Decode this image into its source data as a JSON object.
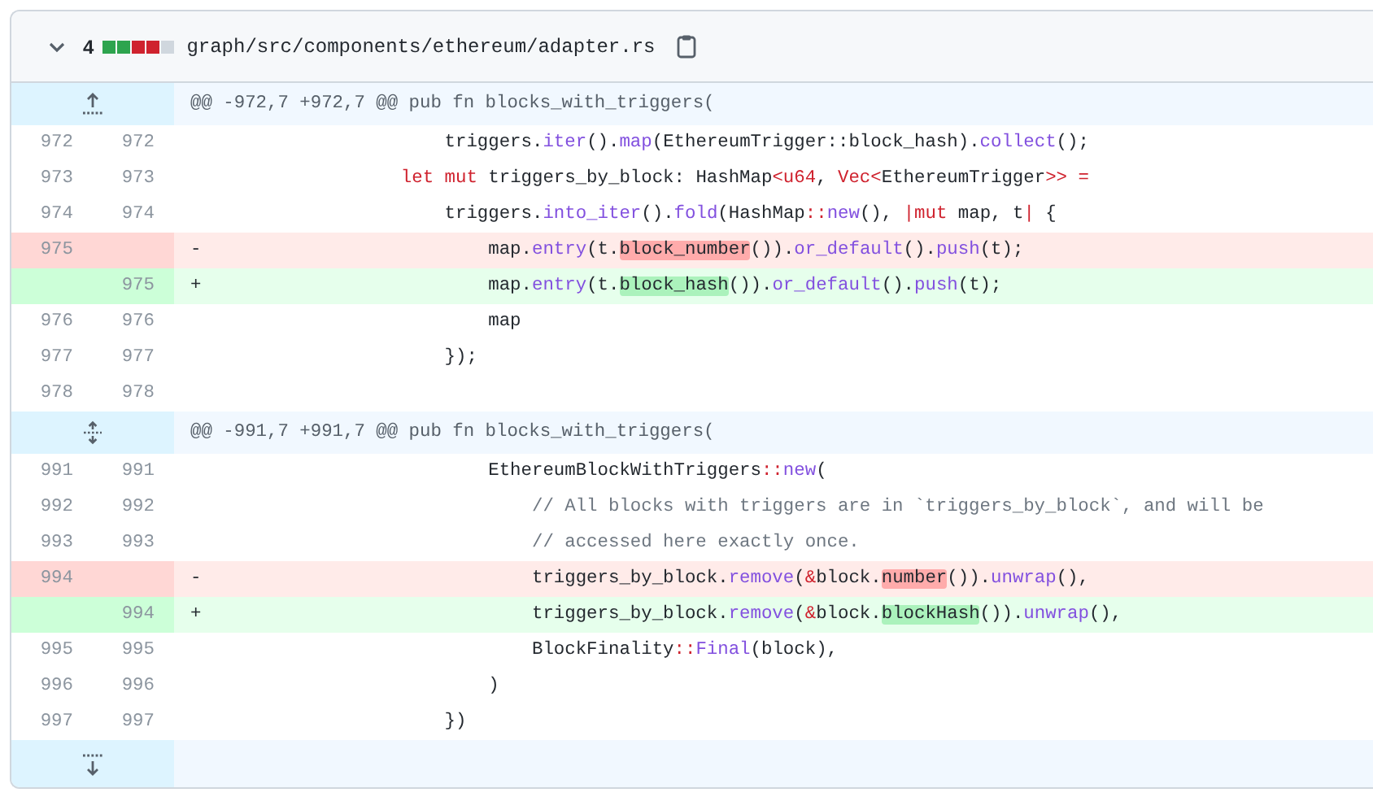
{
  "file": {
    "changes": "4",
    "diffstat": [
      {
        "kind": "add"
      },
      {
        "kind": "add"
      },
      {
        "kind": "del"
      },
      {
        "kind": "del"
      },
      {
        "kind": "neutral"
      }
    ],
    "path": "graph/src/components/ethereum/adapter.rs"
  },
  "hunks": [
    {
      "kind": "up",
      "header": "@@ -972,7 +972,7 @@ pub fn blocks_with_triggers(",
      "lines": [
        {
          "kind": "context",
          "old": "972",
          "new": "972",
          "tokens": [
            {
              "t": "                    triggers.",
              "kind": "plain"
            },
            {
              "t": "iter",
              "kind": "method"
            },
            {
              "t": "().",
              "kind": "plain"
            },
            {
              "t": "map",
              "kind": "method"
            },
            {
              "t": "(EthereumTrigger::block_hash).",
              "kind": "plain"
            },
            {
              "t": "collect",
              "kind": "method"
            },
            {
              "t": "();",
              "kind": "plain"
            }
          ]
        },
        {
          "kind": "context",
          "old": "973",
          "new": "973",
          "tokens": [
            {
              "t": "                let mut",
              "kind": "keyword"
            },
            {
              "t": " triggers_by_block: HashMap",
              "kind": "plain"
            },
            {
              "t": "<u64",
              "kind": "keyword"
            },
            {
              "t": ", ",
              "kind": "plain"
            },
            {
              "t": "Vec<",
              "kind": "keyword"
            },
            {
              "t": "EthereumTrigger",
              "kind": "plain"
            },
            {
              "t": ">> =",
              "kind": "keyword"
            }
          ]
        },
        {
          "kind": "context",
          "old": "974",
          "new": "974",
          "tokens": [
            {
              "t": "                    triggers.",
              "kind": "plain"
            },
            {
              "t": "into_iter",
              "kind": "method"
            },
            {
              "t": "().",
              "kind": "plain"
            },
            {
              "t": "fold",
              "kind": "method"
            },
            {
              "t": "(HashMap",
              "kind": "plain"
            },
            {
              "t": "::",
              "kind": "keyword"
            },
            {
              "t": "new",
              "kind": "method"
            },
            {
              "t": "(), ",
              "kind": "plain"
            },
            {
              "t": "|mut",
              "kind": "keyword"
            },
            {
              "t": " map, t",
              "kind": "plain"
            },
            {
              "t": "|",
              "kind": "keyword"
            },
            {
              "t": " {",
              "kind": "plain"
            }
          ]
        },
        {
          "kind": "del",
          "old": "975",
          "sign": "-",
          "tokens": [
            {
              "t": "                        map.",
              "kind": "plain"
            },
            {
              "t": "entry",
              "kind": "method"
            },
            {
              "t": "(t.",
              "kind": "plain"
            },
            {
              "t": "block_number",
              "kind": "changed"
            },
            {
              "t": "()).",
              "kind": "plain"
            },
            {
              "t": "or_default",
              "kind": "method"
            },
            {
              "t": "().",
              "kind": "plain"
            },
            {
              "t": "push",
              "kind": "method"
            },
            {
              "t": "(t);",
              "kind": "plain"
            }
          ]
        },
        {
          "kind": "add",
          "new": "975",
          "sign": "+",
          "tokens": [
            {
              "t": "                        map.",
              "kind": "plain"
            },
            {
              "t": "entry",
              "kind": "method"
            },
            {
              "t": "(t.",
              "kind": "plain"
            },
            {
              "t": "block_hash",
              "kind": "changed"
            },
            {
              "t": "()).",
              "kind": "plain"
            },
            {
              "t": "or_default",
              "kind": "method"
            },
            {
              "t": "().",
              "kind": "plain"
            },
            {
              "t": "push",
              "kind": "method"
            },
            {
              "t": "(t);",
              "kind": "plain"
            }
          ]
        },
        {
          "kind": "context",
          "old": "976",
          "new": "976",
          "tokens": [
            {
              "t": "                        map",
              "kind": "plain"
            }
          ]
        },
        {
          "kind": "context",
          "old": "977",
          "new": "977",
          "tokens": [
            {
              "t": "                    });",
              "kind": "plain"
            }
          ]
        },
        {
          "kind": "context",
          "old": "978",
          "new": "978"
        }
      ]
    },
    {
      "kind": "both",
      "header": "@@ -991,7 +991,7 @@ pub fn blocks_with_triggers(",
      "lines": [
        {
          "kind": "context",
          "old": "991",
          "new": "991",
          "tokens": [
            {
              "t": "                        EthereumBlockWithTriggers",
              "kind": "plain"
            },
            {
              "t": "::",
              "kind": "keyword"
            },
            {
              "t": "new",
              "kind": "method"
            },
            {
              "t": "(",
              "kind": "plain"
            }
          ]
        },
        {
          "kind": "context",
          "old": "992",
          "new": "992",
          "tokens": [
            {
              "t": "                            // All blocks with triggers are in `triggers_by_block`, and will be",
              "kind": "comment"
            }
          ]
        },
        {
          "kind": "context",
          "old": "993",
          "new": "993",
          "tokens": [
            {
              "t": "                            // accessed here exactly once.",
              "kind": "comment"
            }
          ]
        },
        {
          "kind": "del",
          "old": "994",
          "sign": "-",
          "tokens": [
            {
              "t": "                            triggers_by_block.",
              "kind": "plain"
            },
            {
              "t": "remove",
              "kind": "method"
            },
            {
              "t": "(",
              "kind": "plain"
            },
            {
              "t": "&",
              "kind": "keyword"
            },
            {
              "t": "block.",
              "kind": "plain"
            },
            {
              "t": "number",
              "kind": "changed"
            },
            {
              "t": "()).",
              "kind": "plain"
            },
            {
              "t": "unwrap",
              "kind": "method"
            },
            {
              "t": "(),",
              "kind": "plain"
            }
          ]
        },
        {
          "kind": "add",
          "new": "994",
          "sign": "+",
          "tokens": [
            {
              "t": "                            triggers_by_block.",
              "kind": "plain"
            },
            {
              "t": "remove",
              "kind": "method"
            },
            {
              "t": "(",
              "kind": "plain"
            },
            {
              "t": "&",
              "kind": "keyword"
            },
            {
              "t": "block.",
              "kind": "plain"
            },
            {
              "t": "blockHash",
              "kind": "changed"
            },
            {
              "t": "()).",
              "kind": "plain"
            },
            {
              "t": "unwrap",
              "kind": "method"
            },
            {
              "t": "(),",
              "kind": "plain"
            }
          ]
        },
        {
          "kind": "context",
          "old": "995",
          "new": "995",
          "tokens": [
            {
              "t": "                            BlockFinality",
              "kind": "plain"
            },
            {
              "t": "::",
              "kind": "keyword"
            },
            {
              "t": "Final",
              "kind": "method"
            },
            {
              "t": "(block),",
              "kind": "plain"
            }
          ]
        },
        {
          "kind": "context",
          "old": "996",
          "new": "996",
          "tokens": [
            {
              "t": "                        )",
              "kind": "plain"
            }
          ]
        },
        {
          "kind": "context",
          "old": "997",
          "new": "997",
          "tokens": [
            {
              "t": "                    })",
              "kind": "plain"
            }
          ]
        }
      ]
    }
  ],
  "footer": {
    "kind": "down"
  }
}
